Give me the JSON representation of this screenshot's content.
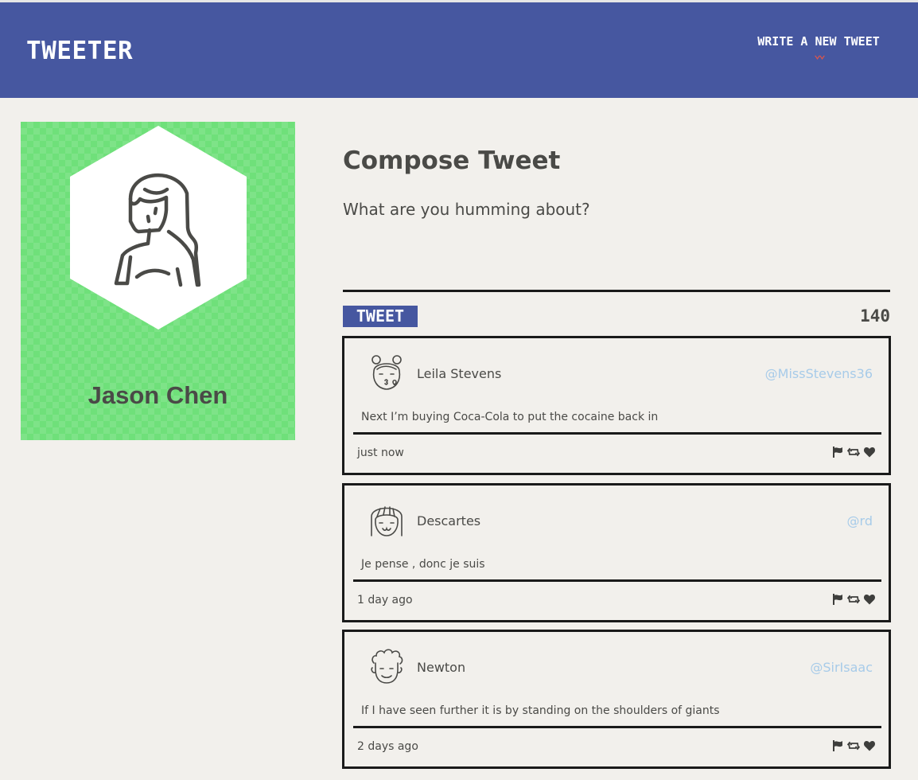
{
  "nav": {
    "brand": "TWEETER",
    "write_link": "WRITE A NEW TWEET",
    "write_link_icon": "double-chevron-down-icon"
  },
  "profile": {
    "name": "Jason Chen",
    "avatar_icon": "person-long-hair-avatar-icon",
    "background_color": "#6fe07a"
  },
  "compose": {
    "title": "Compose Tweet",
    "placeholder": "What are you humming about?",
    "button_label": "TWEET",
    "counter": "140"
  },
  "tweets": [
    {
      "name": "Leila Stevens",
      "handle": "@MissStevens36",
      "text": "Next I’m buying Coca-Cola to put the cocaine back in",
      "time": "just now",
      "avatar_icon": "girl-buns-kiss-avatar-icon"
    },
    {
      "name": "Descartes",
      "handle": "@rd",
      "text": "Je pense , donc je suis",
      "time": "1 day ago",
      "avatar_icon": "long-hair-smile-avatar-icon"
    },
    {
      "name": "Newton",
      "handle": "@SirIsaac",
      "text": "If I have seen further it is by standing on the shoulders of giants",
      "time": "2 days ago",
      "avatar_icon": "curly-hair-avatar-icon"
    }
  ],
  "colors": {
    "nav": "#4657a0",
    "background": "#f2f0ec",
    "accent": "#e05548",
    "handle": "#a7cbe9"
  }
}
